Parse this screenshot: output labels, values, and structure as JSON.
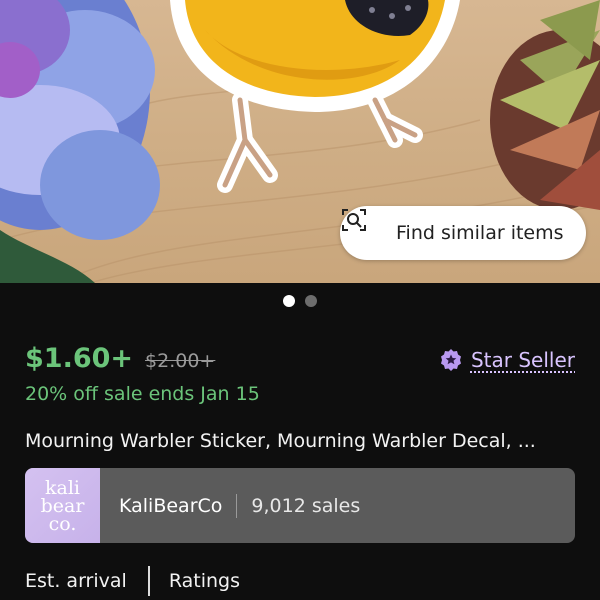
{
  "hero": {
    "find_similar_label": "Find similar items",
    "carousel": {
      "count": 2,
      "active": 1
    },
    "logo_lines": [
      "kali",
      "bear",
      "co."
    ]
  },
  "listing": {
    "price": "$1.60+",
    "original_price": "$2.00+",
    "sale_text": "20% off sale ends Jan 15",
    "star_seller_label": "Star Seller",
    "title": "Mourning Warbler Sticker, Mourning Warbler Decal, ..."
  },
  "shop": {
    "name": "KaliBearCo",
    "sales": "9,012 sales"
  },
  "tabs": {
    "est_arrival": "Est. arrival",
    "ratings": "Ratings"
  },
  "colors": {
    "accent_green": "#6bc47a",
    "star_purple": "#d9c4ff",
    "background": "#0e0e0e"
  }
}
